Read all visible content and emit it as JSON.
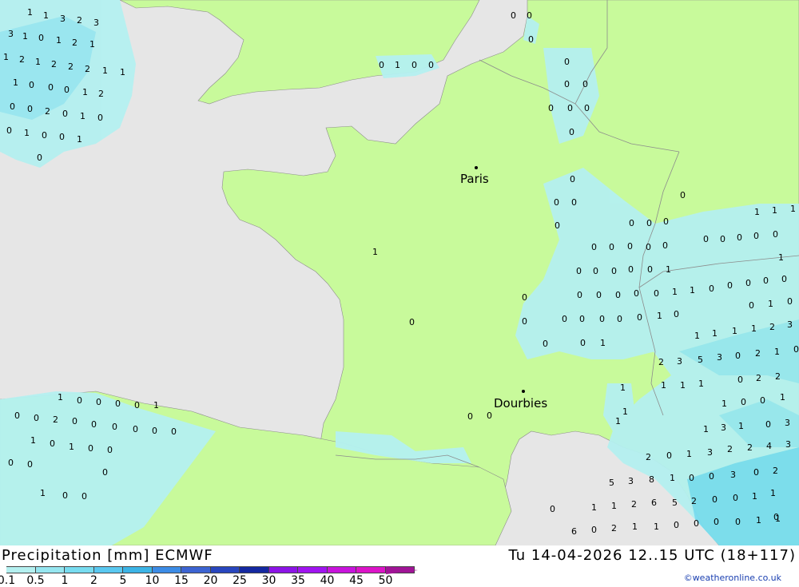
{
  "title": "Precipitation [mm] ECMWF",
  "datetime": "Tu 14-04-2026 12..15 UTC (18+117)",
  "credit": "©weatheronline.co.uk",
  "cities": [
    {
      "name": "Paris"
    },
    {
      "name": "Dourbies"
    }
  ],
  "legend": {
    "labels": [
      "0.1",
      "0.5",
      "1",
      "2",
      "5",
      "10",
      "15",
      "20",
      "25",
      "30",
      "35",
      "40",
      "45",
      "50"
    ],
    "colors": [
      "#b4f0f0",
      "#96e6f0",
      "#78dcf0",
      "#5ac8f0",
      "#3cb4e6",
      "#3c8ce6",
      "#3c64d2",
      "#2846be",
      "#1428a0",
      "#8c14e6",
      "#a014f0",
      "#c814dc",
      "#dc14c8",
      "#a01496"
    ]
  },
  "colors": {
    "sea": "#e6e6e6",
    "land": "#c8fa9b",
    "border": "#8c8c8c"
  },
  "precip_values": [
    "1",
    "1",
    "3",
    "2",
    "3",
    "3",
    "1",
    "0",
    "1",
    "2",
    "1",
    "1",
    "2",
    "1",
    "2",
    "2",
    "2",
    "1",
    "1",
    "1",
    "0",
    "0",
    "0",
    "1",
    "2",
    "0",
    "0",
    "2",
    "0",
    "1",
    "0",
    "0",
    "1",
    "0",
    "0",
    "1",
    "0",
    "0",
    "1",
    "0",
    "0",
    "0",
    "0",
    "0",
    "0",
    "0",
    "0",
    "0",
    "0",
    "0",
    "0",
    "0",
    "0",
    "0",
    "0",
    "0",
    "0",
    "0",
    "0",
    "0",
    "0",
    "0",
    "0",
    "0",
    "0",
    "0",
    "0",
    "0",
    "0",
    "0",
    "0",
    "0",
    "0",
    "0",
    "1",
    "0",
    "0",
    "0",
    "0",
    "0",
    "1",
    "1",
    "0",
    "0",
    "0",
    "0",
    "0",
    "0",
    "0",
    "0",
    "0",
    "0",
    "0",
    "0",
    "1",
    "0",
    "0",
    "1",
    "0",
    "1",
    "1",
    "1",
    "1",
    "1",
    "0",
    "0",
    "0",
    "1",
    "1",
    "1",
    "1",
    "1",
    "2",
    "3",
    "2",
    "3",
    "5",
    "3",
    "0",
    "2",
    "1",
    "0",
    "1",
    "1",
    "1",
    "0",
    "2",
    "2",
    "1",
    "0",
    "0",
    "1",
    "1",
    "3",
    "1",
    "0",
    "3",
    "2",
    "2",
    "4",
    "3",
    "2",
    "0",
    "1",
    "3",
    "0",
    "2",
    "5",
    "3",
    "8",
    "1",
    "0",
    "0",
    "3",
    "1",
    "1",
    "1",
    "2",
    "6",
    "5",
    "2",
    "0",
    "0",
    "1",
    "0",
    "6",
    "0",
    "2",
    "1",
    "1",
    "0",
    "0",
    "0",
    "0",
    "1",
    "1",
    "1",
    "1",
    "1",
    "0",
    "0",
    "0",
    "1",
    "0",
    "0",
    "0",
    "0",
    "1",
    "0",
    "0",
    "2",
    "0",
    "0",
    "0",
    "0",
    "0",
    "0",
    "1",
    "0",
    "1",
    "0",
    "0",
    "0",
    "0",
    "0",
    "1",
    "0",
    "0"
  ]
}
